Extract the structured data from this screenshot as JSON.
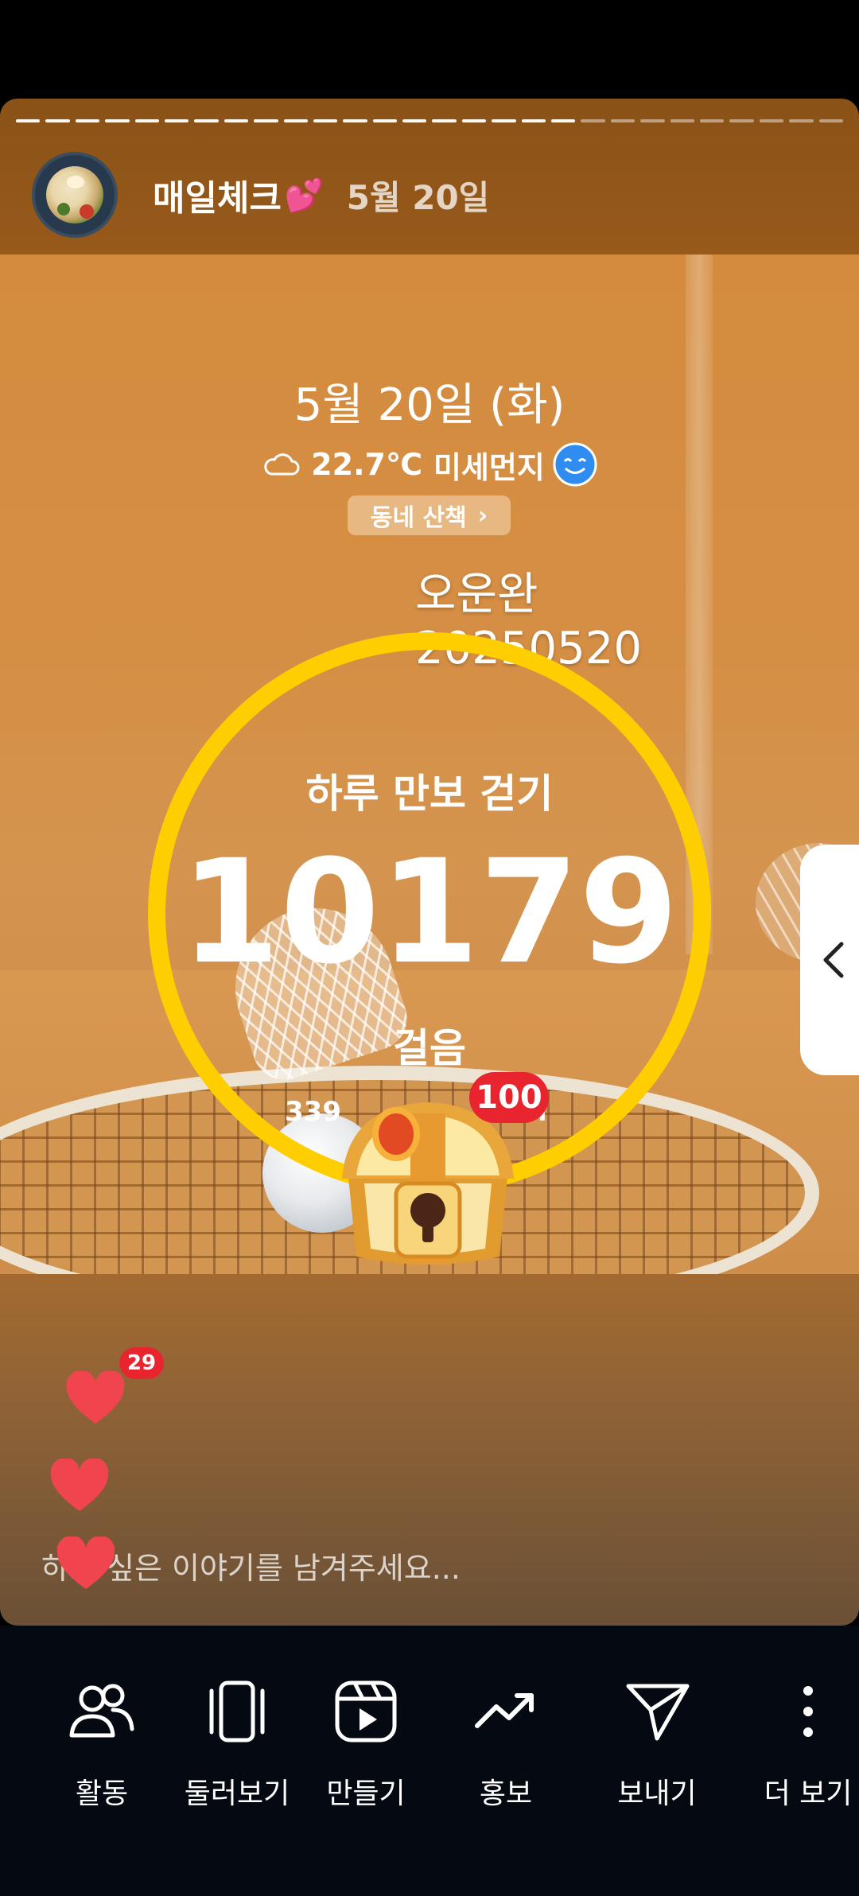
{
  "story": {
    "username": "매일체크",
    "username_emoji": "💕",
    "post_date": "5월 20일",
    "progress_segments": 28,
    "progress_done": 19
  },
  "overlay": {
    "date_line": "5월 20일 (화)",
    "weather_icon": "cloud-icon",
    "temperature": "22.7℃",
    "dust_label": "미세먼지",
    "dust_icon": "smile-face-icon",
    "walk_button": "동네 산책",
    "hashtag": "오운완 20250520",
    "ring_title": "하루 만보 걷기",
    "step_count": "10179",
    "step_unit": "걸음",
    "sub_stat": "339",
    "sub_stat_right": "l",
    "chest_badge": "100"
  },
  "reactions": {
    "mini_badge": "29"
  },
  "reply": {
    "placeholder": "하고 싶은 이야기를 남겨주세요..."
  },
  "actions": [
    {
      "label": "활동",
      "icon": "people-icon"
    },
    {
      "label": "둘러보기",
      "icon": "carousel-icon"
    },
    {
      "label": "만들기",
      "icon": "reels-icon"
    },
    {
      "label": "홍보",
      "icon": "trending-icon"
    },
    {
      "label": "보내기",
      "icon": "send-icon"
    },
    {
      "label": "더 보기",
      "icon": "more-icon"
    }
  ],
  "colors": {
    "ring": "#ffce00",
    "badge": "#e8242f",
    "heart": "#f0454f",
    "action_bar": "#050a12"
  }
}
